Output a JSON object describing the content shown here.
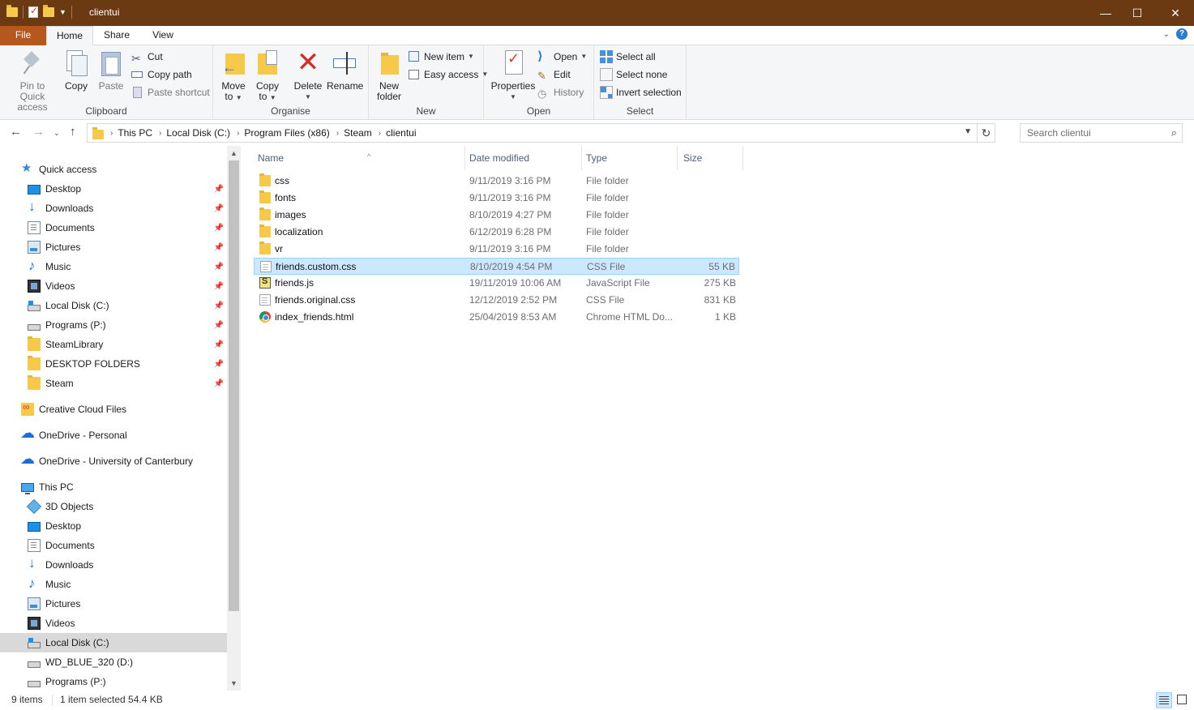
{
  "window": {
    "title": "clientui",
    "controls": {
      "minimize": "—",
      "maximize": "☐",
      "close": "✕"
    }
  },
  "tabs": {
    "file": "File",
    "home": "Home",
    "share": "Share",
    "view": "View"
  },
  "ribbon": {
    "clipboard": {
      "label": "Clipboard",
      "pin_line1": "Pin to Quick",
      "pin_line2": "access",
      "copy": "Copy",
      "paste": "Paste",
      "cut": "Cut",
      "copy_path": "Copy path",
      "paste_shortcut": "Paste shortcut"
    },
    "organise": {
      "label": "Organise",
      "move_line1": "Move",
      "move_line2": "to",
      "copy_line1": "Copy",
      "copy_line2": "to",
      "delete": "Delete",
      "rename": "Rename"
    },
    "new": {
      "label": "New",
      "new_folder_line1": "New",
      "new_folder_line2": "folder",
      "new_item": "New item",
      "easy_access": "Easy access"
    },
    "open": {
      "label": "Open",
      "properties": "Properties",
      "open": "Open",
      "edit": "Edit",
      "history": "History"
    },
    "select": {
      "label": "Select",
      "select_all": "Select all",
      "select_none": "Select none",
      "invert": "Invert selection"
    }
  },
  "address": {
    "crumbs": [
      "This PC",
      "Local Disk (C:)",
      "Program Files (x86)",
      "Steam",
      "clientui"
    ],
    "search_placeholder": "Search clientui"
  },
  "nav": {
    "quick_access": "Quick access",
    "quick_items": [
      "Desktop",
      "Downloads",
      "Documents",
      "Pictures",
      "Music",
      "Videos",
      "Local Disk (C:)",
      "Programs (P:)",
      "SteamLibrary",
      "DESKTOP FOLDERS",
      "Steam"
    ],
    "creative_cloud": "Creative Cloud Files",
    "onedrive_personal": "OneDrive - Personal",
    "onedrive_uc": "OneDrive - University of Canterbury",
    "this_pc": "This PC",
    "pc_items": [
      "3D Objects",
      "Desktop",
      "Documents",
      "Downloads",
      "Music",
      "Pictures",
      "Videos",
      "Local Disk (C:)",
      "WD_BLUE_320 (D:)",
      "Programs (P:)"
    ]
  },
  "columns": {
    "name": "Name",
    "date": "Date modified",
    "type": "Type",
    "size": "Size"
  },
  "files": [
    {
      "name": "css",
      "date": "9/11/2019 3:16 PM",
      "type": "File folder",
      "size": "",
      "icon": "folder-icon"
    },
    {
      "name": "fonts",
      "date": "9/11/2019 3:16 PM",
      "type": "File folder",
      "size": "",
      "icon": "folder-icon"
    },
    {
      "name": "images",
      "date": "8/10/2019 4:27 PM",
      "type": "File folder",
      "size": "",
      "icon": "folder-icon"
    },
    {
      "name": "localization",
      "date": "6/12/2019 6:28 PM",
      "type": "File folder",
      "size": "",
      "icon": "folder-icon"
    },
    {
      "name": "vr",
      "date": "9/11/2019 3:16 PM",
      "type": "File folder",
      "size": "",
      "icon": "folder-icon"
    },
    {
      "name": "friends.custom.css",
      "date": "8/10/2019 4:54 PM",
      "type": "CSS File",
      "size": "55 KB",
      "icon": "css-file-icon"
    },
    {
      "name": "friends.js",
      "date": "19/11/2019 10:06 AM",
      "type": "JavaScript File",
      "size": "275 KB",
      "icon": "js-file-icon"
    },
    {
      "name": "friends.original.css",
      "date": "12/12/2019 2:52 PM",
      "type": "CSS File",
      "size": "831 KB",
      "icon": "css-file-icon"
    },
    {
      "name": "index_friends.html",
      "date": "25/04/2019 8:53 AM",
      "type": "Chrome HTML Do...",
      "size": "1 KB",
      "icon": "chrome-html-icon"
    }
  ],
  "status": {
    "count": "9 items",
    "selection": "1 item selected  54.4 KB"
  },
  "colors": {
    "titlebar": "#6b3a12",
    "file_tab": "#b6571d",
    "selection": "#cce8ff"
  }
}
